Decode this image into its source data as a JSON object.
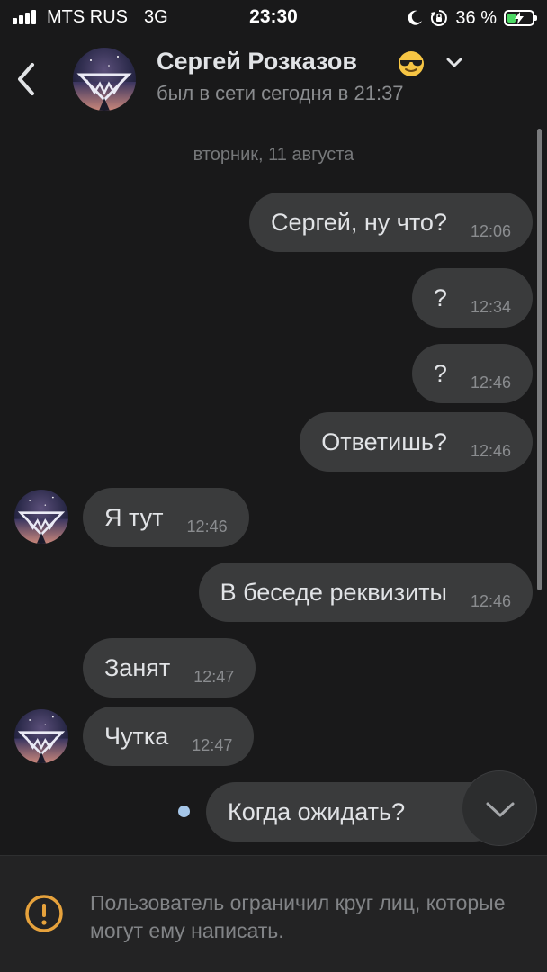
{
  "status_bar": {
    "carrier": "MTS RUS",
    "network": "3G",
    "time": "23:30",
    "battery": "36 %",
    "battery_level": 0.36,
    "icons": [
      "signal-icon",
      "moon-icon",
      "rotation-lock-icon",
      "battery-charging-icon"
    ]
  },
  "header": {
    "name": "Сергей Розказов",
    "emoji": "😎",
    "status": "был в сети сегодня в 21:37"
  },
  "conversation": {
    "date": "вторник, 11 августа",
    "messages": [
      {
        "text": "Сергей, ну что?",
        "time": "12:06",
        "outgoing": true
      },
      {
        "text": "?",
        "time": "12:34",
        "outgoing": true
      },
      {
        "text": "?",
        "time": "12:46",
        "outgoing": true
      },
      {
        "text": "Ответишь?",
        "time": "12:46",
        "outgoing": true
      },
      {
        "text": "Я тут",
        "time": "12:46",
        "outgoing": false
      },
      {
        "text": "В беседе реквизиты",
        "time": "12:46",
        "outgoing": true
      },
      {
        "text": "Занят",
        "time": "12:47",
        "outgoing": false
      },
      {
        "text": "Чутка",
        "time": "12:47",
        "outgoing": false
      },
      {
        "text": "Когда ожидать?",
        "time": "",
        "outgoing": true,
        "unread": true
      }
    ]
  },
  "footer": {
    "notice": "Пользователь ограничил круг лиц, которые могут ему написать."
  },
  "colors": {
    "background": "#19191a",
    "bubble": "#3a3b3c",
    "text": "#e1e3e6",
    "secondary_text": "#8a8c8f",
    "warning": "#e6a23c",
    "battery": "#4cd964"
  }
}
